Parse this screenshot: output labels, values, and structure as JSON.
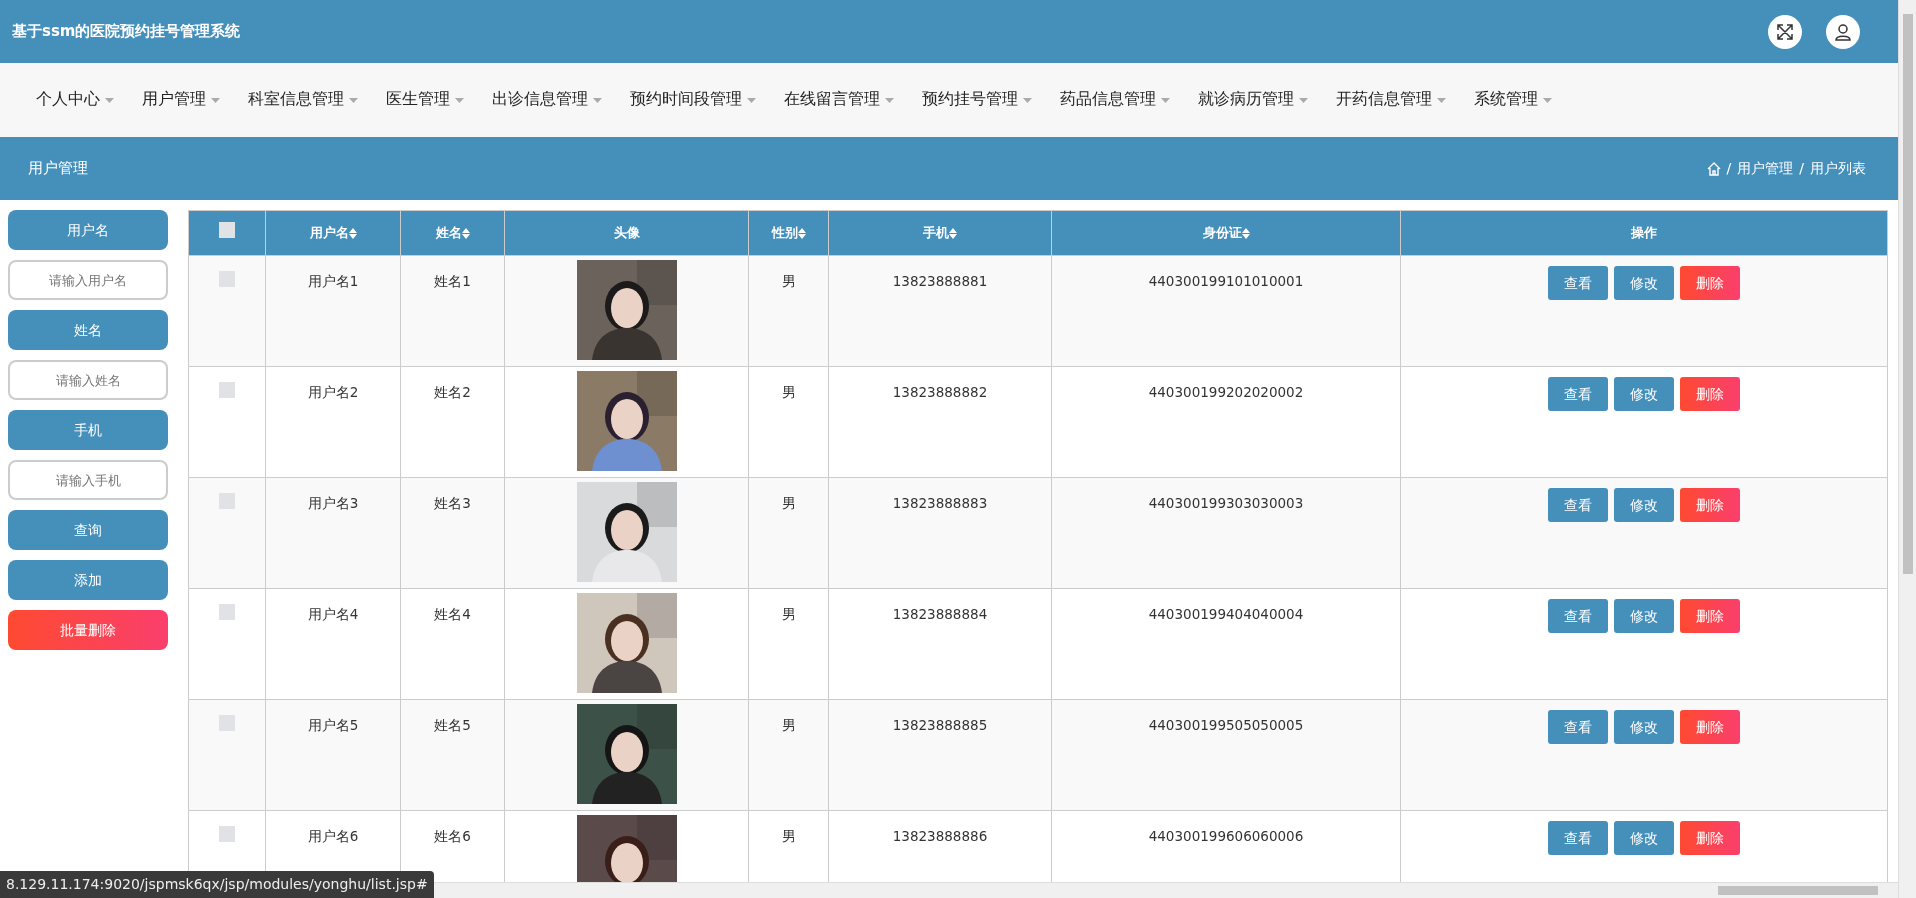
{
  "header": {
    "title": "基于ssm的医院预约挂号管理系统"
  },
  "nav": [
    {
      "label": "个人中心"
    },
    {
      "label": "用户管理"
    },
    {
      "label": "科室信息管理"
    },
    {
      "label": "医生管理"
    },
    {
      "label": "出诊信息管理"
    },
    {
      "label": "预约时间段管理"
    },
    {
      "label": "在线留言管理"
    },
    {
      "label": "预约挂号管理"
    },
    {
      "label": "药品信息管理"
    },
    {
      "label": "就诊病历管理"
    },
    {
      "label": "开药信息管理"
    },
    {
      "label": "系统管理"
    }
  ],
  "page_header": {
    "title": "用户管理",
    "breadcrumb": [
      "用户管理",
      "用户列表"
    ],
    "separator": "/"
  },
  "sidebar": [
    {
      "kind": "label",
      "text": "用户名"
    },
    {
      "kind": "input",
      "placeholder": "请输入用户名"
    },
    {
      "kind": "label",
      "text": "姓名"
    },
    {
      "kind": "input",
      "placeholder": "请输入姓名"
    },
    {
      "kind": "label",
      "text": "手机"
    },
    {
      "kind": "input",
      "placeholder": "请输入手机"
    },
    {
      "kind": "button",
      "text": "查询"
    },
    {
      "kind": "button",
      "text": "添加"
    },
    {
      "kind": "danger",
      "text": "批量删除"
    }
  ],
  "table": {
    "select_all": {
      "checked": false
    },
    "columns": [
      {
        "label": "用户名",
        "sortable": true
      },
      {
        "label": "姓名",
        "sortable": true
      },
      {
        "label": "头像",
        "sortable": false
      },
      {
        "label": "性别",
        "sortable": true
      },
      {
        "label": "手机",
        "sortable": true
      },
      {
        "label": "身份证",
        "sortable": true
      },
      {
        "label": "操作",
        "sortable": false
      }
    ],
    "rows": [
      {
        "checked": false,
        "username": "用户名1",
        "name": "姓名1",
        "gender": "男",
        "phone": "13823888881",
        "id_card": "440300199101010001",
        "actions": [
          "查看",
          "修改",
          "删除"
        ]
      },
      {
        "checked": false,
        "username": "用户名2",
        "name": "姓名2",
        "gender": "男",
        "phone": "13823888882",
        "id_card": "440300199202020002",
        "actions": [
          "查看",
          "修改",
          "删除"
        ]
      },
      {
        "checked": false,
        "username": "用户名3",
        "name": "姓名3",
        "gender": "男",
        "phone": "13823888883",
        "id_card": "440300199303030003",
        "actions": [
          "查看",
          "修改",
          "删除"
        ]
      },
      {
        "checked": false,
        "username": "用户名4",
        "name": "姓名4",
        "gender": "男",
        "phone": "13823888884",
        "id_card": "440300199404040004",
        "actions": [
          "查看",
          "修改",
          "删除"
        ]
      },
      {
        "checked": false,
        "username": "用户名5",
        "name": "姓名5",
        "gender": "男",
        "phone": "13823888885",
        "id_card": "440300199505050005",
        "actions": [
          "查看",
          "修改",
          "删除"
        ]
      },
      {
        "checked": false,
        "username": "用户名6",
        "name": "姓名6",
        "gender": "男",
        "phone": "13823888886",
        "id_card": "440300199606060006",
        "actions": [
          "查看",
          "修改",
          "删除"
        ]
      }
    ]
  },
  "status_bar": {
    "url": "8.129.11.174:9020/jspmsk6qx/jsp/modules/yonghu/list.jsp#"
  }
}
